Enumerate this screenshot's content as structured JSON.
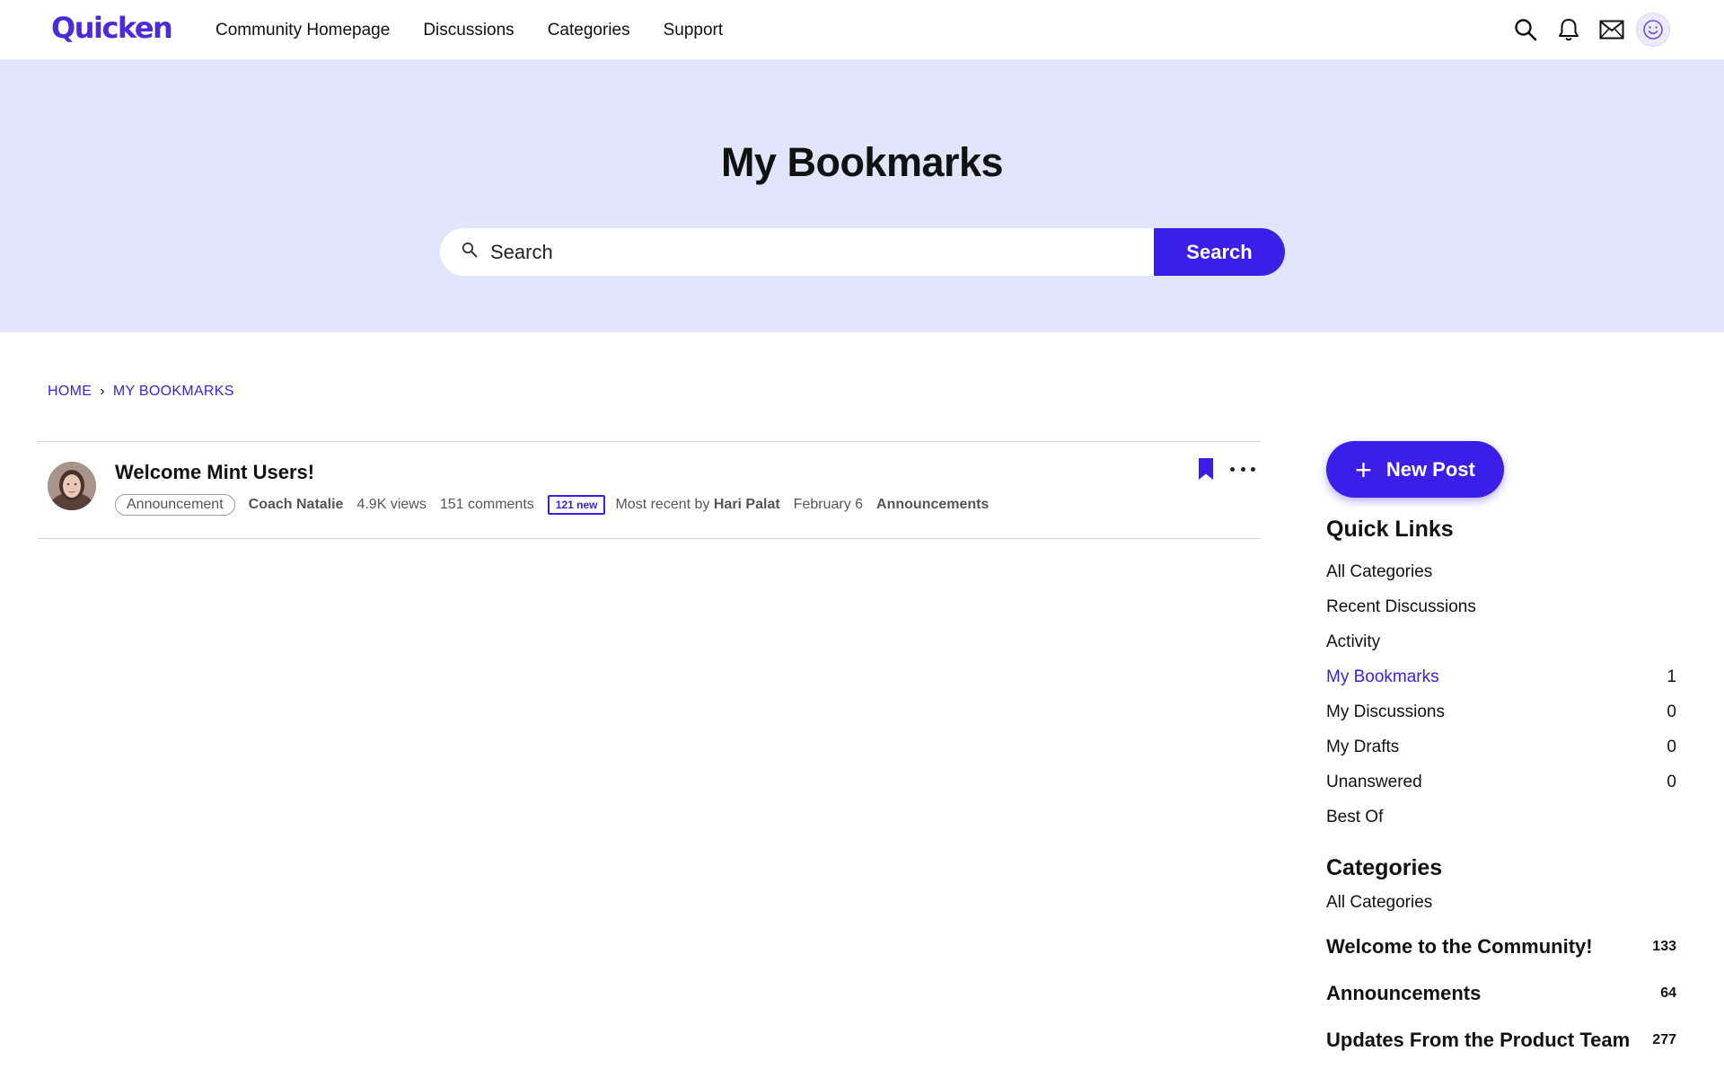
{
  "header": {
    "logo": "Quicken",
    "nav": [
      "Community Homepage",
      "Discussions",
      "Categories",
      "Support"
    ]
  },
  "hero": {
    "title": "My Bookmarks",
    "search_placeholder": "Search",
    "search_button": "Search"
  },
  "breadcrumb": {
    "home": "HOME",
    "separator": "›",
    "current": "MY BOOKMARKS"
  },
  "discussion": {
    "title": "Welcome Mint Users!",
    "tag": "Announcement",
    "author": "Coach Natalie",
    "views": "4.9K views",
    "comments": "151 comments",
    "new_badge": "121 new",
    "most_recent_prefix": "Most recent by",
    "most_recent_user": "Hari Palat",
    "date": "February 6",
    "category": "Announcements"
  },
  "sidebar": {
    "new_post": "New Post",
    "quick_links_title": "Quick Links",
    "quick_links": [
      {
        "label": "All Categories",
        "count": ""
      },
      {
        "label": "Recent Discussions",
        "count": ""
      },
      {
        "label": "Activity",
        "count": ""
      },
      {
        "label": "My Bookmarks",
        "count": "1"
      },
      {
        "label": "My Discussions",
        "count": "0"
      },
      {
        "label": "My Drafts",
        "count": "0"
      },
      {
        "label": "Unanswered",
        "count": "0"
      },
      {
        "label": "Best Of",
        "count": ""
      }
    ],
    "categories_title": "Categories",
    "all_categories": "All Categories",
    "categories": [
      {
        "label": "Welcome to the Community!",
        "count": "133"
      },
      {
        "label": "Announcements",
        "count": "64"
      },
      {
        "label": "Updates From the Product Team",
        "count": "277"
      }
    ]
  },
  "colors": {
    "brand": "#3b1ee8",
    "hero_bg": "#e1e4fb"
  }
}
